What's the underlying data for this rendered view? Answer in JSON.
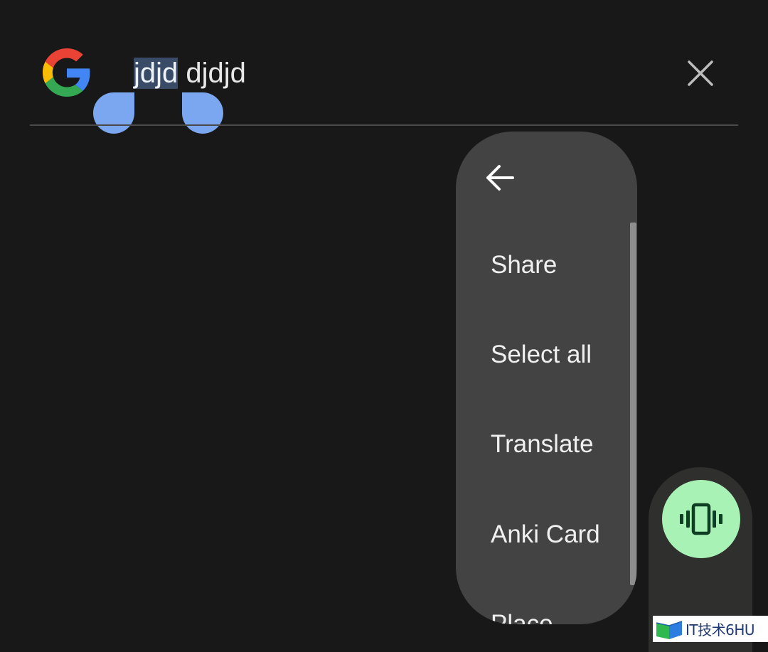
{
  "search": {
    "query_selected": "jdjd",
    "query_rest": " djdjd",
    "selection_color": "#3a4b68",
    "handle_color": "#7aa7f0"
  },
  "icons": {
    "logo": "google-g-logo",
    "close": "close-icon",
    "back": "arrow-left-icon",
    "fab": "vibrate-icon"
  },
  "context_menu": {
    "items": [
      {
        "label": "Share"
      },
      {
        "label": "Select all"
      },
      {
        "label": "Translate"
      },
      {
        "label": "Anki Card"
      },
      {
        "label": "Place"
      }
    ]
  },
  "fab": {
    "color": "#a9f2b6"
  },
  "watermark": {
    "text": "IT技术6HU"
  }
}
